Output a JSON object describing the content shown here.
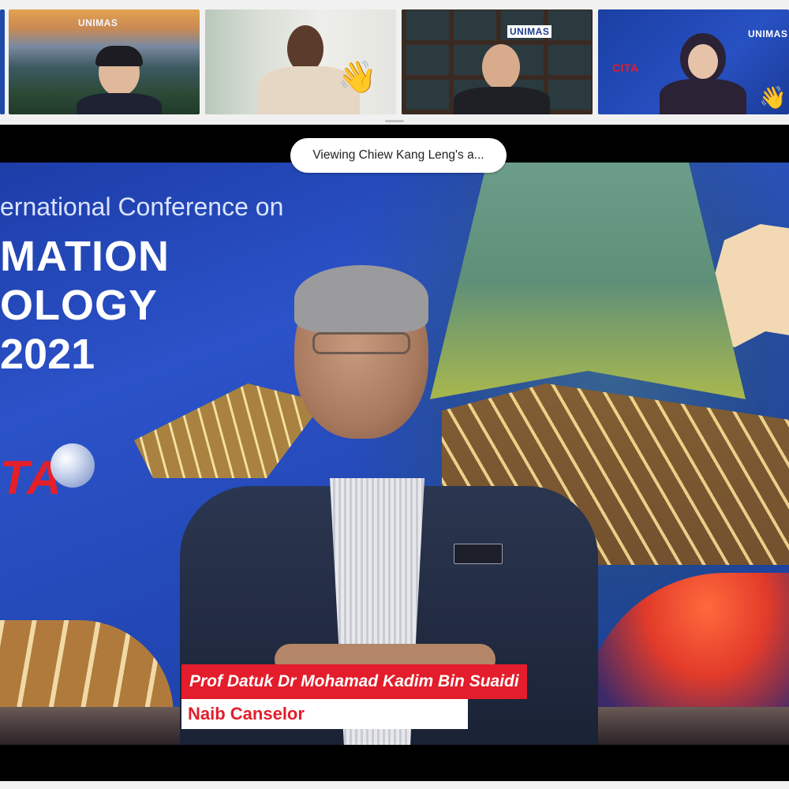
{
  "meeting": {
    "viewing_banner": "Viewing Chiew Kang Leng's a..."
  },
  "participants": [
    {
      "id": "p1",
      "logo_text": "UNIMAS",
      "reaction": ""
    },
    {
      "id": "p2",
      "logo_text": "",
      "reaction": "👋"
    },
    {
      "id": "p3",
      "logo_text": "UNIMAS",
      "reaction": ""
    },
    {
      "id": "p4",
      "logo_text": "UNIMAS",
      "reaction": "👋",
      "poster_text": "CITA"
    }
  ],
  "shared_screen": {
    "headline_top": "ernational Conference on",
    "headline_lines": [
      "MATION",
      "OLOGY",
      "2021"
    ],
    "logo_text": "TA"
  },
  "lower_third": {
    "name": "Prof Datuk Dr Mohamad Kadim Bin Suaidi",
    "title": "Naib Canselor"
  },
  "colors": {
    "caption_red": "#e31d2b",
    "slide_blue": "#2449b8"
  },
  "icons": {
    "reaction": "waving-hand-icon",
    "globe": "globe-icon"
  }
}
